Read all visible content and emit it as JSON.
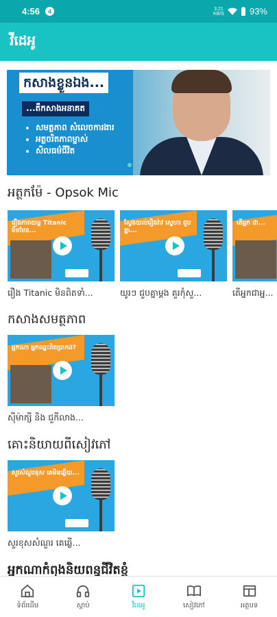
{
  "status": {
    "time": "4:56",
    "notif_badge": "4",
    "net_top": "3.21",
    "net_bottom": "KB/S",
    "battery": "93%"
  },
  "appbar": {
    "title": "វីដេអូ"
  },
  "banner": {
    "title": "កសាងខ្លួនឯង...",
    "subtitle": "...តឹកសាងអនាគត",
    "bullets": [
      "សមត្ថភាព សំលេចការងារ",
      "អត្ថចរិតភាពម្ចាស់",
      "សិលធម៌ជីវិត"
    ]
  },
  "sections": [
    {
      "title": "អត្ថកម៉ែ - Opsok Mic",
      "cards": [
        {
          "thumb_text": "រឿងភាពយន្ត Titanic មិនមែន...",
          "caption": "រឿង Titanic មិនពិតទាំ..."
        },
        {
          "thumb_text": "ស្វែងយល់រឿងរ៉ាវ ស្នេហា ជួបគ្នា...",
          "caption": "យូរៗ ជួបគ្នាម្តង គួរកុំសួ..."
        },
        {
          "thumb_text": "តើអ្នក ជា...",
          "caption": "តើអ្នកជាអ្ន..."
        }
      ]
    },
    {
      "title": "កសាងសមត្ថភាព",
      "cards": [
        {
          "thumb_text": "អ្នកណា អ្នកឈ្នះពិតប្រាកដ?",
          "caption": "ស៊ីម៉ាក្សី និង ជួកីលាង..."
        }
      ]
    },
    {
      "title": "គោះនិយាយពីសៀវភៅ",
      "cards": [
        {
          "thumb_text": "សួរសំណួរខុស គេមិនឆ្លើយ...",
          "caption": "សួរខុសសំណួរ គេឆ្លើ..."
        }
      ]
    },
    {
      "title": "អ្នកណាកំពុងនិយពន្ធជីវិតខ្ញុំ",
      "cards": []
    }
  ],
  "nav": {
    "items": [
      {
        "label": "ទំព័រដើម",
        "icon": "home-icon"
      },
      {
        "label": "ស្តាប់",
        "icon": "headphones-icon"
      },
      {
        "label": "វីដេអូ",
        "icon": "video-icon"
      },
      {
        "label": "សៀវភៅ",
        "icon": "book-icon"
      },
      {
        "label": "អត្ថបទ",
        "icon": "article-icon"
      }
    ],
    "active_index": 2
  },
  "colors": {
    "primary": "#19c3c4",
    "status": "#0aa7ad",
    "thumb_bg": "#2aa6e0",
    "thumb_strip": "#f39a2b"
  }
}
